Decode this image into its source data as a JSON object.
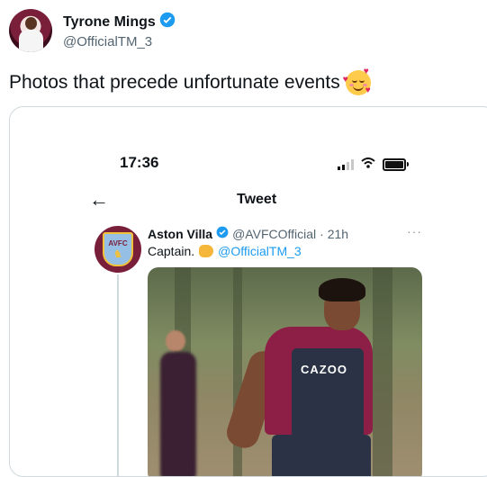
{
  "author": {
    "name": "Tyrone Mings",
    "handle": "@OfficialTM_3",
    "verified_color": "#1d9bf0"
  },
  "tweet": {
    "text": "Photos that precede unfortunate events",
    "emoji": "smiling-face-with-hearts"
  },
  "screenshot": {
    "status_time": "17:36",
    "title": "Tweet",
    "back_icon": "arrow-left",
    "quoted": {
      "name": "Aston Villa",
      "handle": "@AVFCOfficial",
      "time": "· 21h",
      "text": "Captain.",
      "mention": "@OfficialTM_3",
      "crest_text": "AVFC"
    },
    "photo": {
      "sponsor": "CAZOO"
    }
  },
  "colors": {
    "claret": "#7a1f3a",
    "sky_blue": "#95bfe5",
    "link": "#1d9bf0"
  }
}
